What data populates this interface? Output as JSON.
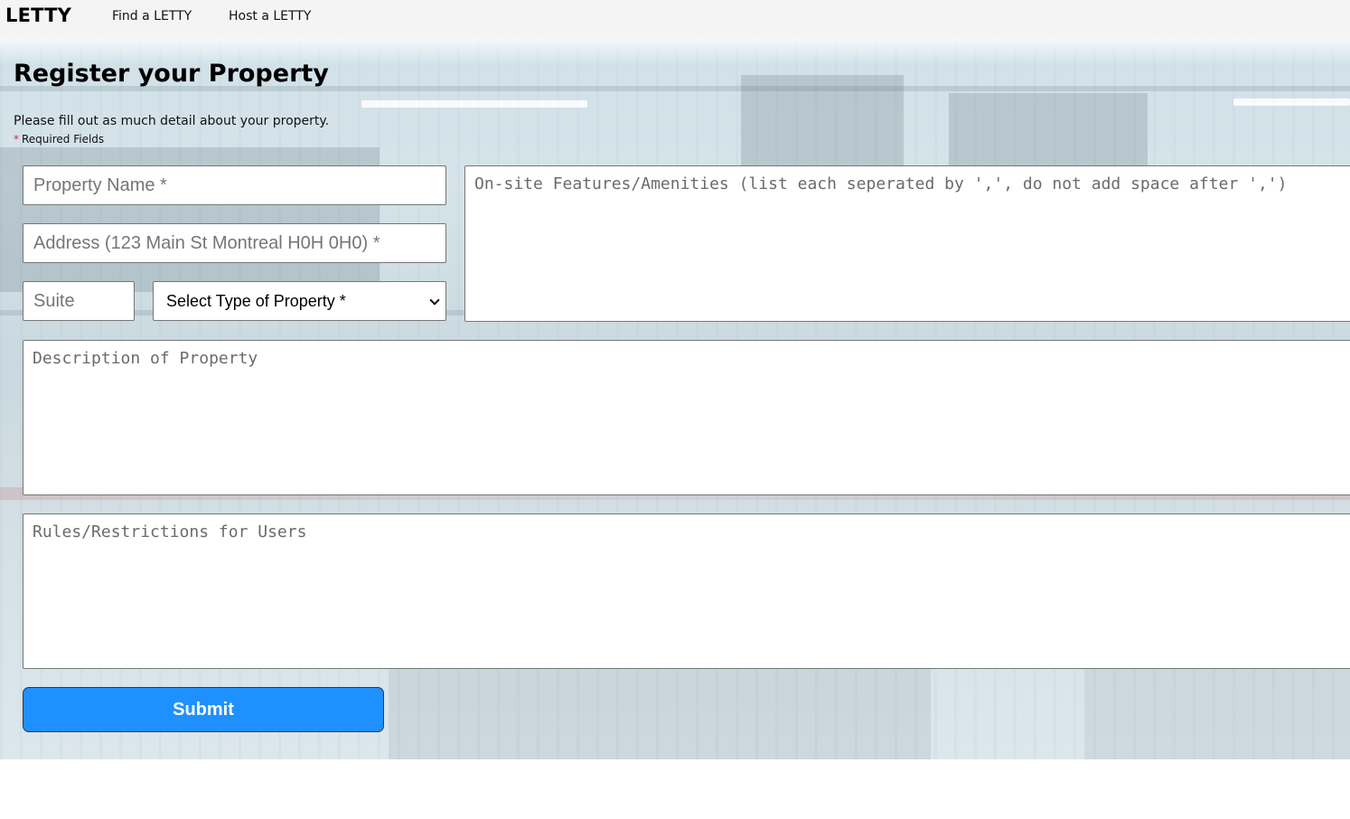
{
  "nav": {
    "brand": "LETTY",
    "links": [
      "Find a LETTY",
      "Host a LETTY"
    ]
  },
  "page": {
    "title": "Register your Property",
    "intro": "Please fill out as much detail about your property.",
    "required_star": "*",
    "required_note": "Required Fields"
  },
  "form": {
    "property_name": {
      "value": "",
      "placeholder": "Property Name *"
    },
    "address": {
      "value": "",
      "placeholder": "Address (123 Main St Montreal H0H 0H0) *"
    },
    "suite": {
      "value": "",
      "placeholder": "Suite"
    },
    "property_type": {
      "selected": "Select Type of Property *"
    },
    "features": {
      "value": "",
      "placeholder": "On-site Features/Amenities (list each seperated by ',', do not add space after ',')"
    },
    "description": {
      "value": "",
      "placeholder": "Description of Property"
    },
    "rules": {
      "value": "",
      "placeholder": "Rules/Restrictions for Users"
    },
    "submit_label": "Submit"
  },
  "colors": {
    "submit_bg": "#1e90ff",
    "required_star": "#e0262b",
    "navbar_bg": "#f4f4f4"
  },
  "icons": {
    "select_arrow": "chevron-down-icon"
  }
}
